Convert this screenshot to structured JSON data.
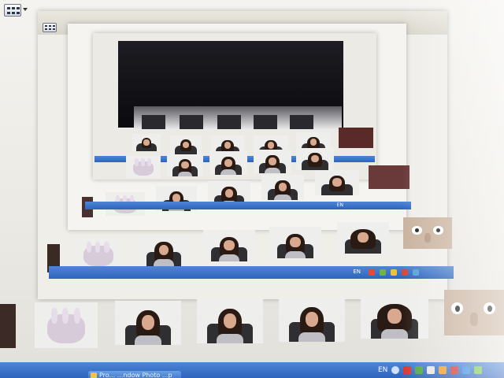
{
  "toolbar": {
    "view_menu_icon": "thumbnails-view-icon",
    "dropdown_icon": "chevron-down-icon"
  },
  "taskbar": {
    "language": "EN",
    "task_button_label": "Pro... ...ndow Photo ...p",
    "tray_icons": [
      "back-icon",
      "pdf-icon",
      "network-icon",
      "volume-icon",
      "antivirus-icon",
      "chat-icon",
      "shield-icon",
      "update-icon"
    ]
  },
  "colors": {
    "taskbar_blue": "#2f63bd",
    "frame_bg": "#f2f1ed",
    "screen_dark": "#111114"
  }
}
